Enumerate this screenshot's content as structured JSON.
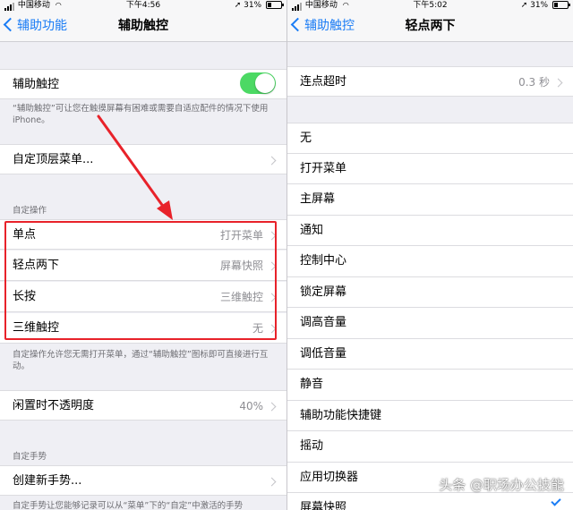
{
  "left": {
    "status": {
      "carrier": "中国移动",
      "time": "下午4:56",
      "battery": "31%"
    },
    "nav": {
      "back": "辅助功能",
      "title": "辅助触控"
    },
    "toggle_row": {
      "label": "辅助触控",
      "on": true
    },
    "toggle_note": "“辅助触控”可让您在触摸屏幕有困难或需要自适应配件的情况下使用 iPhone。",
    "top_menu": "自定顶层菜单...",
    "custom_header": "自定操作",
    "actions": [
      {
        "label": "单点",
        "value": "打开菜单"
      },
      {
        "label": "轻点两下",
        "value": "屏幕快照"
      },
      {
        "label": "长按",
        "value": "三维触控"
      },
      {
        "label": "三维触控",
        "value": "无"
      }
    ],
    "actions_note": "自定操作允许您无需打开菜单，通过“辅助触控”图标即可直接进行互动。",
    "idle": {
      "label": "闲置时不透明度",
      "value": "40%"
    },
    "gesture_header": "自定手势",
    "new_gesture": "创建新手势...",
    "bottom_note": "自定手势让您能够记录可以从“菜单”下的“自定”中激活的手势"
  },
  "right": {
    "status": {
      "carrier": "中国移动",
      "time": "下午5:02",
      "battery": "31%"
    },
    "nav": {
      "back": "辅助触控",
      "title": "轻点两下"
    },
    "timeout": {
      "label": "连点超时",
      "value": "0.3 秒"
    },
    "options": [
      "无",
      "打开菜单",
      "主屏幕",
      "通知",
      "控制中心",
      "锁定屏幕",
      "调高音量",
      "调低音量",
      "静音",
      "辅助功能快捷键",
      "摇动",
      "应用切换器",
      "屏幕快照"
    ],
    "selected_index": 12
  },
  "watermark": "头条 @职场办公技能",
  "colors": {
    "accent": "#1a7cf5",
    "toggle_on": "#4cd964",
    "highlight": "#e8222a"
  }
}
